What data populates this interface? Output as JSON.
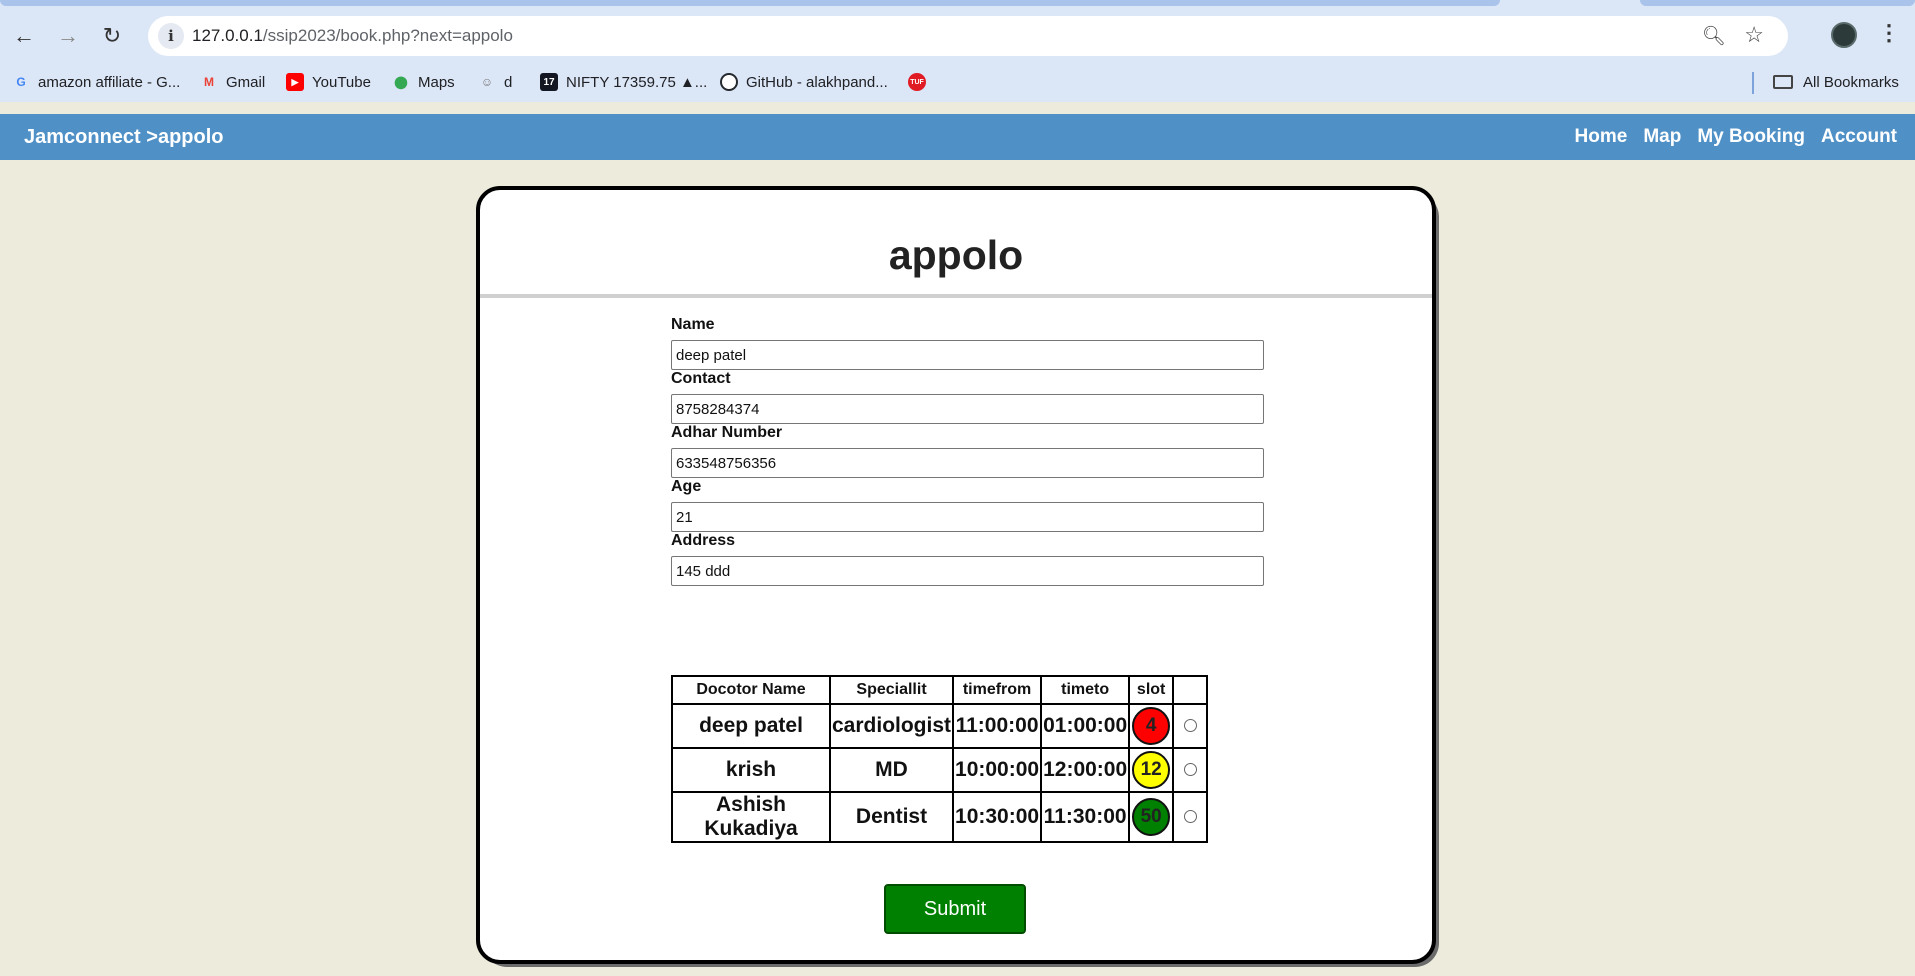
{
  "browser": {
    "url_host": "127.0.0.1",
    "url_path": "/ssip2023/book.php?next=appolo",
    "bookmarks": [
      {
        "label": "amazon affiliate - G...",
        "icon": "google-icon",
        "color": "#4285f4"
      },
      {
        "label": "Gmail",
        "icon": "gmail-icon",
        "color": "#ea4335"
      },
      {
        "label": "YouTube",
        "icon": "youtube-icon",
        "color": "#ff0000"
      },
      {
        "label": "Maps",
        "icon": "maps-icon",
        "color": "#34a853"
      },
      {
        "label": "d",
        "icon": "mascot-icon",
        "color": "#777777"
      },
      {
        "label": "NIFTY 17359.75 ▲...",
        "icon": "tradingview-icon",
        "color": "#131722"
      },
      {
        "label": "GitHub - alakhpand...",
        "icon": "github-icon",
        "color": "#24292e"
      },
      {
        "label": "",
        "icon": "tuf-icon",
        "color": "#e01b24"
      }
    ],
    "all_bookmarks": "All Bookmarks"
  },
  "header": {
    "brand": "Jamconnect >appolo",
    "nav": [
      "Home",
      "Map",
      "My Booking",
      "Account"
    ],
    "bg_color": "#4f91c7"
  },
  "card": {
    "title": "appolo"
  },
  "form": {
    "name": {
      "label": "Name",
      "value": "deep patel"
    },
    "contact": {
      "label": "Contact",
      "value": "8758284374"
    },
    "adhar": {
      "label": "Adhar Number",
      "value": "633548756356"
    },
    "age": {
      "label": "Age",
      "value": "21"
    },
    "address": {
      "label": "Address",
      "value": "145 ddd"
    }
  },
  "table": {
    "headers": [
      "Docotor Name",
      "Speciallit",
      "timefrom",
      "timeto",
      "slot",
      ""
    ],
    "rows": [
      {
        "doctor": "deep patel",
        "speciality": "cardiologist",
        "timefrom": "11:00:00",
        "timeto": "01:00:00",
        "slot": "4",
        "slot_color": "#ff0000"
      },
      {
        "doctor": "krish",
        "speciality": "MD",
        "timefrom": "10:00:00",
        "timeto": "12:00:00",
        "slot": "12",
        "slot_color": "#ffff00"
      },
      {
        "doctor": "Ashish Kukadiya",
        "speciality": "Dentist",
        "timefrom": "10:30:00",
        "timeto": "11:30:00",
        "slot": "50",
        "slot_color": "#008000"
      }
    ]
  },
  "submit_label": "Submit"
}
